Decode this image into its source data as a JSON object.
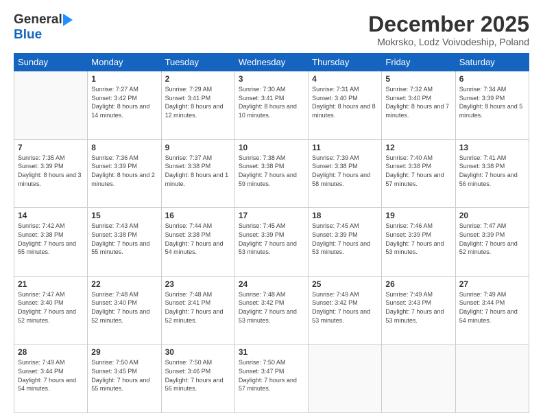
{
  "header": {
    "logo_general": "General",
    "logo_blue": "Blue",
    "month": "December 2025",
    "location": "Mokrsko, Lodz Voivodeship, Poland"
  },
  "weekdays": [
    "Sunday",
    "Monday",
    "Tuesday",
    "Wednesday",
    "Thursday",
    "Friday",
    "Saturday"
  ],
  "weeks": [
    [
      {
        "date": "",
        "sunrise": "",
        "sunset": "",
        "daylight": ""
      },
      {
        "date": "1",
        "sunrise": "Sunrise: 7:27 AM",
        "sunset": "Sunset: 3:42 PM",
        "daylight": "Daylight: 8 hours and 14 minutes."
      },
      {
        "date": "2",
        "sunrise": "Sunrise: 7:29 AM",
        "sunset": "Sunset: 3:41 PM",
        "daylight": "Daylight: 8 hours and 12 minutes."
      },
      {
        "date": "3",
        "sunrise": "Sunrise: 7:30 AM",
        "sunset": "Sunset: 3:41 PM",
        "daylight": "Daylight: 8 hours and 10 minutes."
      },
      {
        "date": "4",
        "sunrise": "Sunrise: 7:31 AM",
        "sunset": "Sunset: 3:40 PM",
        "daylight": "Daylight: 8 hours and 8 minutes."
      },
      {
        "date": "5",
        "sunrise": "Sunrise: 7:32 AM",
        "sunset": "Sunset: 3:40 PM",
        "daylight": "Daylight: 8 hours and 7 minutes."
      },
      {
        "date": "6",
        "sunrise": "Sunrise: 7:34 AM",
        "sunset": "Sunset: 3:39 PM",
        "daylight": "Daylight: 8 hours and 5 minutes."
      }
    ],
    [
      {
        "date": "7",
        "sunrise": "Sunrise: 7:35 AM",
        "sunset": "Sunset: 3:39 PM",
        "daylight": "Daylight: 8 hours and 3 minutes."
      },
      {
        "date": "8",
        "sunrise": "Sunrise: 7:36 AM",
        "sunset": "Sunset: 3:39 PM",
        "daylight": "Daylight: 8 hours and 2 minutes."
      },
      {
        "date": "9",
        "sunrise": "Sunrise: 7:37 AM",
        "sunset": "Sunset: 3:38 PM",
        "daylight": "Daylight: 8 hours and 1 minute."
      },
      {
        "date": "10",
        "sunrise": "Sunrise: 7:38 AM",
        "sunset": "Sunset: 3:38 PM",
        "daylight": "Daylight: 7 hours and 59 minutes."
      },
      {
        "date": "11",
        "sunrise": "Sunrise: 7:39 AM",
        "sunset": "Sunset: 3:38 PM",
        "daylight": "Daylight: 7 hours and 58 minutes."
      },
      {
        "date": "12",
        "sunrise": "Sunrise: 7:40 AM",
        "sunset": "Sunset: 3:38 PM",
        "daylight": "Daylight: 7 hours and 57 minutes."
      },
      {
        "date": "13",
        "sunrise": "Sunrise: 7:41 AM",
        "sunset": "Sunset: 3:38 PM",
        "daylight": "Daylight: 7 hours and 56 minutes."
      }
    ],
    [
      {
        "date": "14",
        "sunrise": "Sunrise: 7:42 AM",
        "sunset": "Sunset: 3:38 PM",
        "daylight": "Daylight: 7 hours and 55 minutes."
      },
      {
        "date": "15",
        "sunrise": "Sunrise: 7:43 AM",
        "sunset": "Sunset: 3:38 PM",
        "daylight": "Daylight: 7 hours and 55 minutes."
      },
      {
        "date": "16",
        "sunrise": "Sunrise: 7:44 AM",
        "sunset": "Sunset: 3:38 PM",
        "daylight": "Daylight: 7 hours and 54 minutes."
      },
      {
        "date": "17",
        "sunrise": "Sunrise: 7:45 AM",
        "sunset": "Sunset: 3:39 PM",
        "daylight": "Daylight: 7 hours and 53 minutes."
      },
      {
        "date": "18",
        "sunrise": "Sunrise: 7:45 AM",
        "sunset": "Sunset: 3:39 PM",
        "daylight": "Daylight: 7 hours and 53 minutes."
      },
      {
        "date": "19",
        "sunrise": "Sunrise: 7:46 AM",
        "sunset": "Sunset: 3:39 PM",
        "daylight": "Daylight: 7 hours and 53 minutes."
      },
      {
        "date": "20",
        "sunrise": "Sunrise: 7:47 AM",
        "sunset": "Sunset: 3:39 PM",
        "daylight": "Daylight: 7 hours and 52 minutes."
      }
    ],
    [
      {
        "date": "21",
        "sunrise": "Sunrise: 7:47 AM",
        "sunset": "Sunset: 3:40 PM",
        "daylight": "Daylight: 7 hours and 52 minutes."
      },
      {
        "date": "22",
        "sunrise": "Sunrise: 7:48 AM",
        "sunset": "Sunset: 3:40 PM",
        "daylight": "Daylight: 7 hours and 52 minutes."
      },
      {
        "date": "23",
        "sunrise": "Sunrise: 7:48 AM",
        "sunset": "Sunset: 3:41 PM",
        "daylight": "Daylight: 7 hours and 52 minutes."
      },
      {
        "date": "24",
        "sunrise": "Sunrise: 7:48 AM",
        "sunset": "Sunset: 3:42 PM",
        "daylight": "Daylight: 7 hours and 53 minutes."
      },
      {
        "date": "25",
        "sunrise": "Sunrise: 7:49 AM",
        "sunset": "Sunset: 3:42 PM",
        "daylight": "Daylight: 7 hours and 53 minutes."
      },
      {
        "date": "26",
        "sunrise": "Sunrise: 7:49 AM",
        "sunset": "Sunset: 3:43 PM",
        "daylight": "Daylight: 7 hours and 53 minutes."
      },
      {
        "date": "27",
        "sunrise": "Sunrise: 7:49 AM",
        "sunset": "Sunset: 3:44 PM",
        "daylight": "Daylight: 7 hours and 54 minutes."
      }
    ],
    [
      {
        "date": "28",
        "sunrise": "Sunrise: 7:49 AM",
        "sunset": "Sunset: 3:44 PM",
        "daylight": "Daylight: 7 hours and 54 minutes."
      },
      {
        "date": "29",
        "sunrise": "Sunrise: 7:50 AM",
        "sunset": "Sunset: 3:45 PM",
        "daylight": "Daylight: 7 hours and 55 minutes."
      },
      {
        "date": "30",
        "sunrise": "Sunrise: 7:50 AM",
        "sunset": "Sunset: 3:46 PM",
        "daylight": "Daylight: 7 hours and 56 minutes."
      },
      {
        "date": "31",
        "sunrise": "Sunrise: 7:50 AM",
        "sunset": "Sunset: 3:47 PM",
        "daylight": "Daylight: 7 hours and 57 minutes."
      },
      {
        "date": "",
        "sunrise": "",
        "sunset": "",
        "daylight": ""
      },
      {
        "date": "",
        "sunrise": "",
        "sunset": "",
        "daylight": ""
      },
      {
        "date": "",
        "sunrise": "",
        "sunset": "",
        "daylight": ""
      }
    ]
  ]
}
